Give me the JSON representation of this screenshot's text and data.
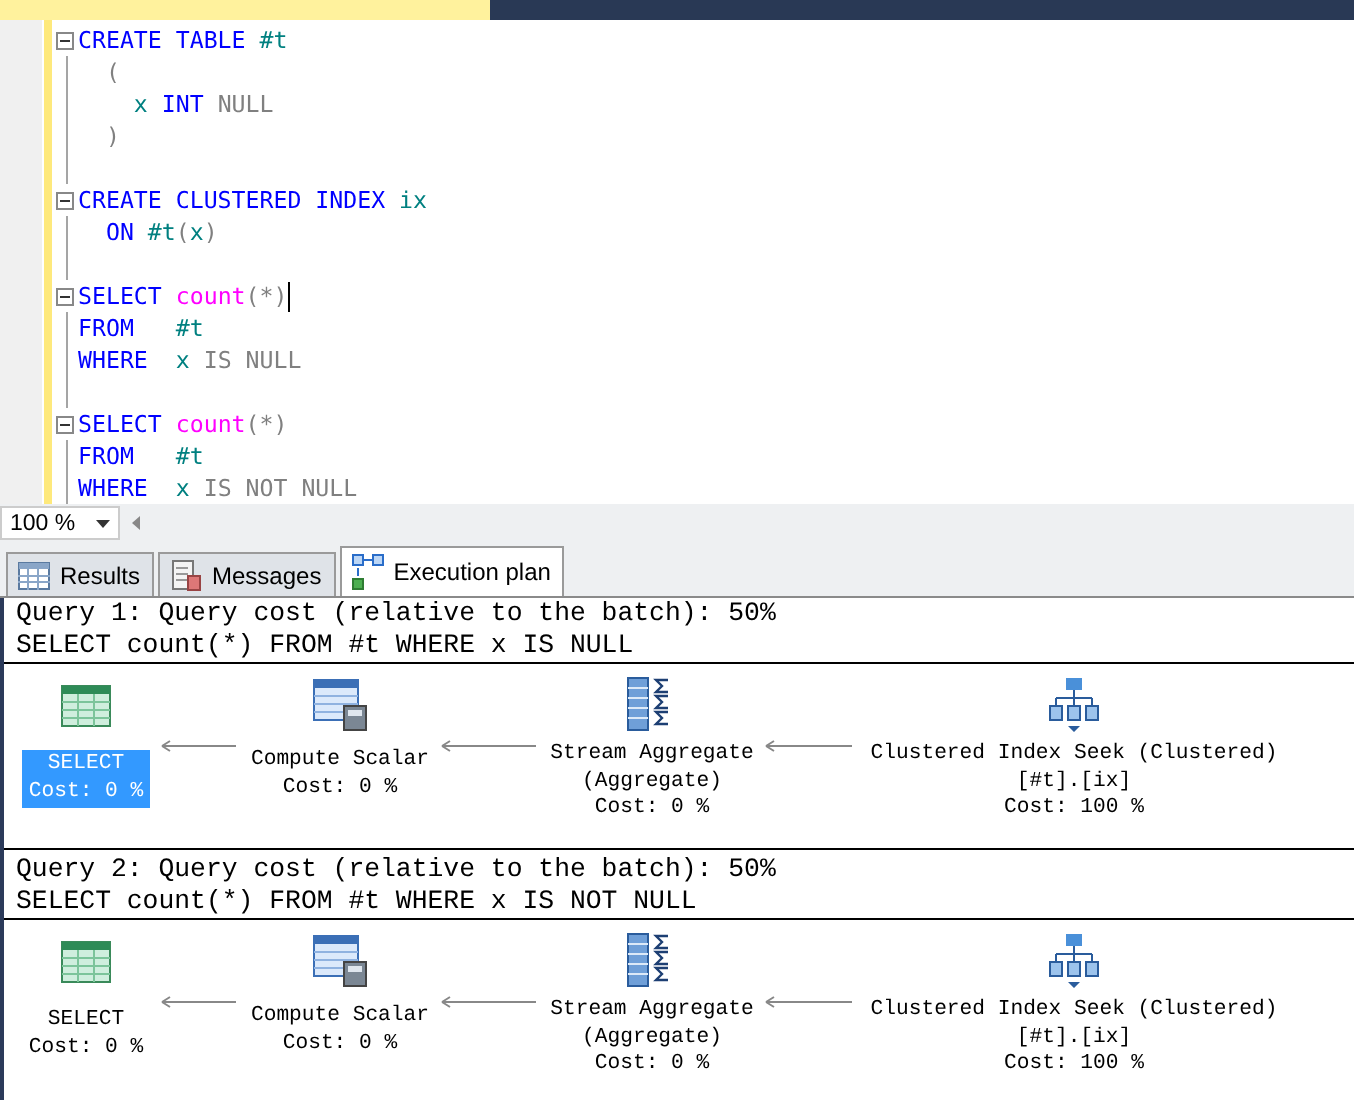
{
  "editor": {
    "lines": [
      {
        "kind": "code",
        "fold": true,
        "cursor": false,
        "segments": [
          {
            "text": "CREATE TABLE ",
            "kind": "keyword"
          },
          {
            "text": "#t",
            "kind": "ident"
          }
        ]
      },
      {
        "kind": "code",
        "fold": false,
        "cursor": false,
        "segments": [
          {
            "text": "  (",
            "kind": "operator"
          }
        ]
      },
      {
        "kind": "code",
        "fold": false,
        "cursor": false,
        "segments": [
          {
            "text": "    x ",
            "kind": "ident"
          },
          {
            "text": "INT ",
            "kind": "keyword"
          },
          {
            "text": "NULL",
            "kind": "operator"
          }
        ]
      },
      {
        "kind": "code",
        "fold": false,
        "cursor": false,
        "segments": [
          {
            "text": "  )",
            "kind": "operator"
          }
        ]
      },
      {
        "kind": "blank"
      },
      {
        "kind": "code",
        "fold": true,
        "cursor": false,
        "segments": [
          {
            "text": "CREATE CLUSTERED INDEX ",
            "kind": "keyword"
          },
          {
            "text": "ix",
            "kind": "ident"
          }
        ]
      },
      {
        "kind": "code",
        "fold": false,
        "cursor": false,
        "segments": [
          {
            "text": "  ON ",
            "kind": "keyword"
          },
          {
            "text": "#t",
            "kind": "ident"
          },
          {
            "text": "(",
            "kind": "operator"
          },
          {
            "text": "x",
            "kind": "ident"
          },
          {
            "text": ")",
            "kind": "operator"
          }
        ]
      },
      {
        "kind": "blank"
      },
      {
        "kind": "code",
        "fold": true,
        "cursor": true,
        "segments": [
          {
            "text": "SELECT ",
            "kind": "keyword"
          },
          {
            "text": "count",
            "kind": "function"
          },
          {
            "text": "(*)",
            "kind": "operator"
          }
        ]
      },
      {
        "kind": "code",
        "fold": false,
        "cursor": false,
        "segments": [
          {
            "text": "FROM   ",
            "kind": "keyword"
          },
          {
            "text": "#t",
            "kind": "ident"
          }
        ]
      },
      {
        "kind": "code",
        "fold": false,
        "cursor": false,
        "segments": [
          {
            "text": "WHERE  ",
            "kind": "keyword"
          },
          {
            "text": "x ",
            "kind": "ident"
          },
          {
            "text": "IS NULL",
            "kind": "operator"
          }
        ]
      },
      {
        "kind": "blank"
      },
      {
        "kind": "code",
        "fold": true,
        "cursor": false,
        "segments": [
          {
            "text": "SELECT ",
            "kind": "keyword"
          },
          {
            "text": "count",
            "kind": "function"
          },
          {
            "text": "(*)",
            "kind": "operator"
          }
        ]
      },
      {
        "kind": "code",
        "fold": false,
        "cursor": false,
        "segments": [
          {
            "text": "FROM   ",
            "kind": "keyword"
          },
          {
            "text": "#t",
            "kind": "ident"
          }
        ]
      },
      {
        "kind": "code",
        "fold": false,
        "cursor": false,
        "segments": [
          {
            "text": "WHERE  ",
            "kind": "keyword"
          },
          {
            "text": "x ",
            "kind": "ident"
          },
          {
            "text": "IS NOT NULL",
            "kind": "operator"
          }
        ]
      }
    ]
  },
  "zoom": {
    "value": "100 %"
  },
  "tabs": [
    {
      "kind": "results",
      "label": "Results",
      "selected": false
    },
    {
      "kind": "messages",
      "label": "Messages",
      "selected": false
    },
    {
      "kind": "plan",
      "label": "Execution plan",
      "selected": true
    }
  ],
  "queries": [
    {
      "header": "Query 1: Query cost (relative to the batch): 50%",
      "statement": "SELECT count(*) FROM #t WHERE x IS NULL",
      "nodes": [
        {
          "kind": "select",
          "selected": true,
          "lines": [
            "SELECT",
            "Cost: 0 %"
          ]
        },
        {
          "kind": "compute",
          "selected": false,
          "lines": [
            "Compute Scalar",
            "Cost: 0 %"
          ]
        },
        {
          "kind": "aggregate",
          "selected": false,
          "lines": [
            "Stream Aggregate",
            "(Aggregate)",
            "Cost: 0 %"
          ]
        },
        {
          "kind": "seek",
          "selected": false,
          "lines": [
            "Clustered Index Seek (Clustered)",
            "[#t].[ix]",
            "Cost: 100 %"
          ]
        }
      ]
    },
    {
      "header": "Query 2: Query cost (relative to the batch): 50%",
      "statement": "SELECT count(*) FROM #t WHERE x IS NOT NULL",
      "nodes": [
        {
          "kind": "select",
          "selected": false,
          "lines": [
            "SELECT",
            "Cost: 0 %"
          ]
        },
        {
          "kind": "compute",
          "selected": false,
          "lines": [
            "Compute Scalar",
            "Cost: 0 %"
          ]
        },
        {
          "kind": "aggregate",
          "selected": false,
          "lines": [
            "Stream Aggregate",
            "(Aggregate)",
            "Cost: 0 %"
          ]
        },
        {
          "kind": "seek",
          "selected": false,
          "lines": [
            "Clustered Index Seek (Clustered)",
            "[#t].[ix]",
            "Cost: 100 %"
          ]
        }
      ]
    }
  ]
}
